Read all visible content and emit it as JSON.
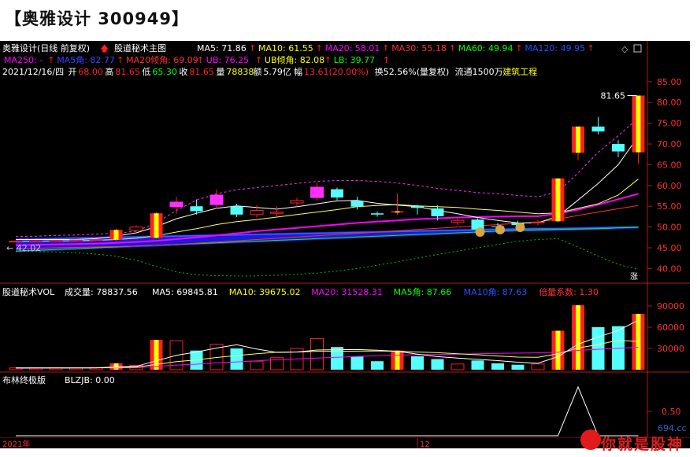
{
  "page": {
    "title": "【奥雅设计 300949】"
  },
  "main": {
    "name": "奥雅设计(日线 前复权)",
    "indicator": "股道秘术主图",
    "ma": [
      {
        "label": "MA5:",
        "value": "71.86",
        "color": "#ffffff"
      },
      {
        "label": "MA10:",
        "value": "61.55",
        "color": "#ffff00"
      },
      {
        "label": "MA20:",
        "value": "58.01",
        "color": "#ff00ff"
      },
      {
        "label": "MA30:",
        "value": "55.18",
        "color": "#ff3030"
      },
      {
        "label": "MA60:",
        "value": "49.94",
        "color": "#00ff00"
      },
      {
        "label": "MA120:",
        "value": "49.95",
        "color": "#2050ff"
      }
    ],
    "line2": [
      {
        "text": "MA250: -",
        "color": "#ff00ff"
      },
      {
        "text": "MA5角: 82.77",
        "color": "#4040ff"
      },
      {
        "text": "MA20倾角: 69.09",
        "color": "#ff3030"
      },
      {
        "text": "UB: 76.25",
        "color": "#ff00ff"
      },
      {
        "text": "UB倾角: 82.08",
        "color": "#ffff00"
      },
      {
        "text": "LB: 39.77",
        "color": "#00ff00"
      }
    ],
    "info": {
      "date": "2021/12/16/四",
      "open_label": "开",
      "open": "68.00",
      "high_label": "高",
      "high": "81.65",
      "low_label": "低",
      "low": "65.30",
      "close_label": "收",
      "close": "81.65",
      "vol_label": "量",
      "vol": "78838",
      "amt_label": "额",
      "amt": "5.79亿",
      "chg_label": "幅",
      "chg": "13.61(20.00%)",
      "turn": "换52.56%(量复权)",
      "float": "流通1500万",
      "sector": "建筑工程"
    },
    "yaxis": [
      "85.00",
      "80.00",
      "75.00",
      "70.00",
      "65.00",
      "60.00",
      "55.00",
      "50.00",
      "45.00",
      "40.00"
    ],
    "high_mark": "81.65",
    "low_mark": "42.02",
    "badge": "涨"
  },
  "vol": {
    "name": "股道秘术VOL",
    "items": [
      {
        "text": "成交量: 78837.56",
        "color": "#ffffff"
      },
      {
        "text": "MA5: 69845.81",
        "color": "#ffffff"
      },
      {
        "text": "MA10: 39675.02",
        "color": "#ffff00"
      },
      {
        "text": "MA20: 31528.31",
        "color": "#ff00ff"
      },
      {
        "text": "MA5角: 87.66",
        "color": "#00ff00"
      },
      {
        "text": "MA10角: 87.63",
        "color": "#3050ff"
      },
      {
        "text": "倍量系数: 1.30",
        "color": "#ff3030"
      }
    ],
    "yaxis": [
      "90000",
      "60000",
      "30000"
    ]
  },
  "boll": {
    "name": "布林终极版",
    "value": "BLZJB: 0.00",
    "yaxis": [
      "0.50"
    ]
  },
  "xaxis": {
    "year": "2021年",
    "month": "12"
  },
  "watermark": {
    "text": "你就是股神",
    "sub": "694.cc"
  },
  "colors": {
    "up": "#ff2020",
    "down": "#54ffff",
    "bg": "#000000",
    "frame": "#b01818"
  },
  "chart_data": {
    "type": "candlestick",
    "price_ylim": [
      38,
      88
    ],
    "vol_ylim": [
      0,
      100000
    ],
    "candles": [
      {
        "o": 46.6,
        "c": 46.6,
        "h": 46.6,
        "l": 46.6,
        "v": 2500
      },
      {
        "o": 46.7,
        "c": 46.7,
        "h": 46.7,
        "l": 46.7,
        "v": 2500
      },
      {
        "o": 46.8,
        "c": 46.8,
        "h": 46.8,
        "l": 46.8,
        "v": 2600
      },
      {
        "o": 46.8,
        "c": 46.9,
        "h": 47.0,
        "l": 46.7,
        "v": 2600
      },
      {
        "o": 46.9,
        "c": 47.0,
        "h": 47.1,
        "l": 46.8,
        "v": 3000
      },
      {
        "o": 47.0,
        "c": 49.3,
        "h": 49.6,
        "l": 46.6,
        "v": 9000,
        "gold": true
      },
      {
        "o": 49.2,
        "c": 50.0,
        "h": 50.4,
        "l": 48.8,
        "v": 6000
      },
      {
        "o": 47.4,
        "c": 53.3,
        "h": 53.6,
        "l": 47.2,
        "v": 42000,
        "gold": true
      },
      {
        "o": 54.9,
        "c": 56.0,
        "h": 57.3,
        "l": 53.2,
        "v": 41000
      },
      {
        "o": 55.0,
        "c": 53.8,
        "h": 56.6,
        "l": 53.0,
        "v": 27000
      },
      {
        "o": 55.4,
        "c": 57.7,
        "h": 59.1,
        "l": 54.4,
        "v": 36000
      },
      {
        "o": 55.0,
        "c": 53.0,
        "h": 55.6,
        "l": 52.4,
        "v": 30000
      },
      {
        "o": 53.0,
        "c": 54.0,
        "h": 55.3,
        "l": 52.3,
        "v": 12000
      },
      {
        "o": 53.3,
        "c": 53.6,
        "h": 55.0,
        "l": 52.7,
        "v": 17000
      },
      {
        "o": 55.8,
        "c": 56.4,
        "h": 57.0,
        "l": 54.9,
        "v": 30000
      },
      {
        "o": 57.1,
        "c": 59.6,
        "h": 60.8,
        "l": 56.4,
        "v": 44000
      },
      {
        "o": 59.1,
        "c": 57.1,
        "h": 59.5,
        "l": 56.5,
        "v": 32000
      },
      {
        "o": 56.3,
        "c": 54.9,
        "h": 57.3,
        "l": 54.2,
        "v": 19000
      },
      {
        "o": 53.3,
        "c": 53.0,
        "h": 53.8,
        "l": 52.5,
        "v": 12000
      },
      {
        "o": 53.5,
        "c": 53.8,
        "h": 58.0,
        "l": 53.0,
        "v": 27000,
        "gold": true
      },
      {
        "o": 55.0,
        "c": 54.6,
        "h": 55.4,
        "l": 53.0,
        "v": 19000
      },
      {
        "o": 54.5,
        "c": 52.6,
        "h": 55.2,
        "l": 51.6,
        "v": 15000
      },
      {
        "o": 51.1,
        "c": 51.6,
        "h": 52.3,
        "l": 50.5,
        "v": 8000
      },
      {
        "o": 51.8,
        "c": 49.4,
        "h": 52.1,
        "l": 49.0,
        "v": 13000
      },
      {
        "o": 50.2,
        "c": 50.0,
        "h": 51.0,
        "l": 49.2,
        "v": 9000
      },
      {
        "o": 51.0,
        "c": 50.5,
        "h": 51.5,
        "l": 49.8,
        "v": 7000
      },
      {
        "o": 51.0,
        "c": 51.2,
        "h": 51.7,
        "l": 50.4,
        "v": 8000
      },
      {
        "o": 51.4,
        "c": 61.7,
        "h": 61.7,
        "l": 51.2,
        "v": 55000,
        "gold": true
      },
      {
        "o": 67.9,
        "c": 74.2,
        "h": 74.2,
        "l": 66.0,
        "v": 91000,
        "gold": true
      },
      {
        "o": 74.2,
        "c": 73.0,
        "h": 76.5,
        "l": 72.3,
        "v": 60000
      },
      {
        "o": 70.0,
        "c": 68.2,
        "h": 70.9,
        "l": 66.8,
        "v": 61500
      },
      {
        "o": 68.0,
        "c": 81.65,
        "h": 81.65,
        "l": 65.3,
        "v": 78838,
        "gold": true
      }
    ],
    "ma5": [
      47.0,
      47.0,
      47.0,
      47.0,
      47.2,
      47.8,
      48.6,
      50.1,
      52.0,
      53.3,
      54.5,
      55.1,
      54.7,
      54.3,
      54.9,
      55.6,
      56.3,
      56.4,
      55.7,
      55.3,
      54.9,
      54.0,
      53.2,
      52.3,
      51.6,
      51.0,
      51.0,
      52.6,
      56.5,
      60.5,
      65.0,
      71.86
    ],
    "ma10": [
      46.6,
      46.6,
      46.7,
      46.7,
      46.8,
      47.0,
      47.3,
      47.9,
      48.8,
      49.6,
      50.6,
      51.3,
      51.8,
      52.4,
      53.0,
      53.6,
      54.2,
      54.9,
      55.2,
      55.4,
      55.1,
      54.9,
      54.7,
      54.3,
      54.0,
      53.6,
      53.2,
      53.4,
      54.5,
      55.6,
      57.7,
      61.55
    ],
    "ma20": [
      45.6,
      45.7,
      45.8,
      45.9,
      46.0,
      46.2,
      46.4,
      46.7,
      47.1,
      47.5,
      48.0,
      48.5,
      49.0,
      49.4,
      49.8,
      50.2,
      50.6,
      51.0,
      51.3,
      51.6,
      51.9,
      52.1,
      52.3,
      52.4,
      52.5,
      52.6,
      52.6,
      53.2,
      54.2,
      55.4,
      56.7,
      58.01
    ],
    "ma30": [
      44.8,
      44.9,
      45.0,
      45.1,
      45.2,
      45.3,
      45.4,
      45.6,
      45.8,
      46.1,
      46.4,
      46.7,
      47.0,
      47.3,
      47.6,
      47.9,
      48.2,
      48.5,
      48.8,
      49.1,
      49.4,
      49.7,
      50.0,
      50.3,
      50.6,
      50.9,
      51.2,
      51.9,
      52.8,
      53.6,
      54.4,
      55.18
    ],
    "ma60": [
      44.2,
      44.4,
      44.6,
      44.8,
      45.0,
      45.2,
      45.4,
      45.6,
      45.8,
      46.0,
      46.2,
      46.4,
      46.6,
      46.8,
      47.0,
      47.2,
      47.4,
      47.6,
      47.8,
      48.0,
      48.2,
      48.4,
      48.6,
      48.8,
      49.0,
      49.2,
      49.3,
      49.4,
      49.5,
      49.6,
      49.8,
      49.94
    ],
    "ma120": [
      47.0,
      47.1,
      47.2,
      47.3,
      47.4,
      47.5,
      47.6,
      47.7,
      47.8,
      47.9,
      48.0,
      48.1,
      48.2,
      48.3,
      48.4,
      48.5,
      48.6,
      48.7,
      48.8,
      48.9,
      49.0,
      49.1,
      49.2,
      49.3,
      49.4,
      49.5,
      49.6,
      49.6,
      49.7,
      49.8,
      49.9,
      49.95
    ],
    "ub": [
      47.7,
      47.8,
      48.0,
      48.1,
      48.3,
      48.5,
      49.0,
      51.0,
      54.0,
      56.5,
      58.0,
      59.0,
      59.5,
      60.0,
      60.5,
      61.0,
      61.2,
      61.2,
      61.0,
      60.6,
      60.0,
      59.3,
      58.8,
      58.3,
      58.0,
      57.6,
      57.3,
      58.5,
      63.0,
      68.0,
      72.0,
      76.25
    ],
    "lb": [
      44.2,
      44.1,
      44.0,
      43.8,
      43.5,
      43.0,
      42.0,
      40.5,
      39.2,
      38.5,
      38.3,
      38.2,
      38.2,
      38.4,
      38.6,
      38.9,
      39.4,
      40.0,
      40.8,
      41.6,
      42.5,
      43.4,
      44.2,
      45.0,
      45.8,
      46.6,
      47.0,
      47.2,
      45.2,
      43.0,
      41.0,
      39.77
    ],
    "vol_ma5": [
      2500,
      2500,
      2550,
      2550,
      2640,
      3940,
      4640,
      12520,
      20200,
      25000,
      30600,
      35200,
      29200,
      24400,
      25000,
      27800,
      28200,
      28400,
      27400,
      26000,
      22000,
      18400,
      16400,
      14600,
      12800,
      10600,
      9000,
      18400,
      36000,
      46200,
      55300,
      69845
    ],
    "vol_ma10": [
      2500,
      2500,
      2500,
      2550,
      2600,
      3200,
      3600,
      7500,
      11300,
      13800,
      17200,
      20000,
      22600,
      24800,
      25000,
      26000,
      26000,
      26200,
      26300,
      26100,
      25000,
      24000,
      22600,
      21100,
      19300,
      17800,
      17500,
      22400,
      30700,
      35400,
      41600,
      39675
    ],
    "vol_ma20": [
      2000,
      2100,
      2200,
      2300,
      2400,
      2600,
      2800,
      4500,
      6500,
      7800,
      9700,
      11000,
      12500,
      14100,
      15200,
      16400,
      17600,
      18800,
      19800,
      20700,
      21200,
      21500,
      22000,
      22500,
      23000,
      23400,
      23800,
      24700,
      27200,
      28800,
      30300,
      31528
    ],
    "boll_zj": [
      0,
      0,
      0,
      0,
      0,
      0,
      0,
      0,
      0,
      0,
      0,
      0,
      0,
      0,
      0,
      0,
      0,
      0,
      0,
      0,
      0,
      0,
      0,
      0,
      0,
      0,
      0,
      0,
      1,
      0,
      0,
      0
    ]
  }
}
